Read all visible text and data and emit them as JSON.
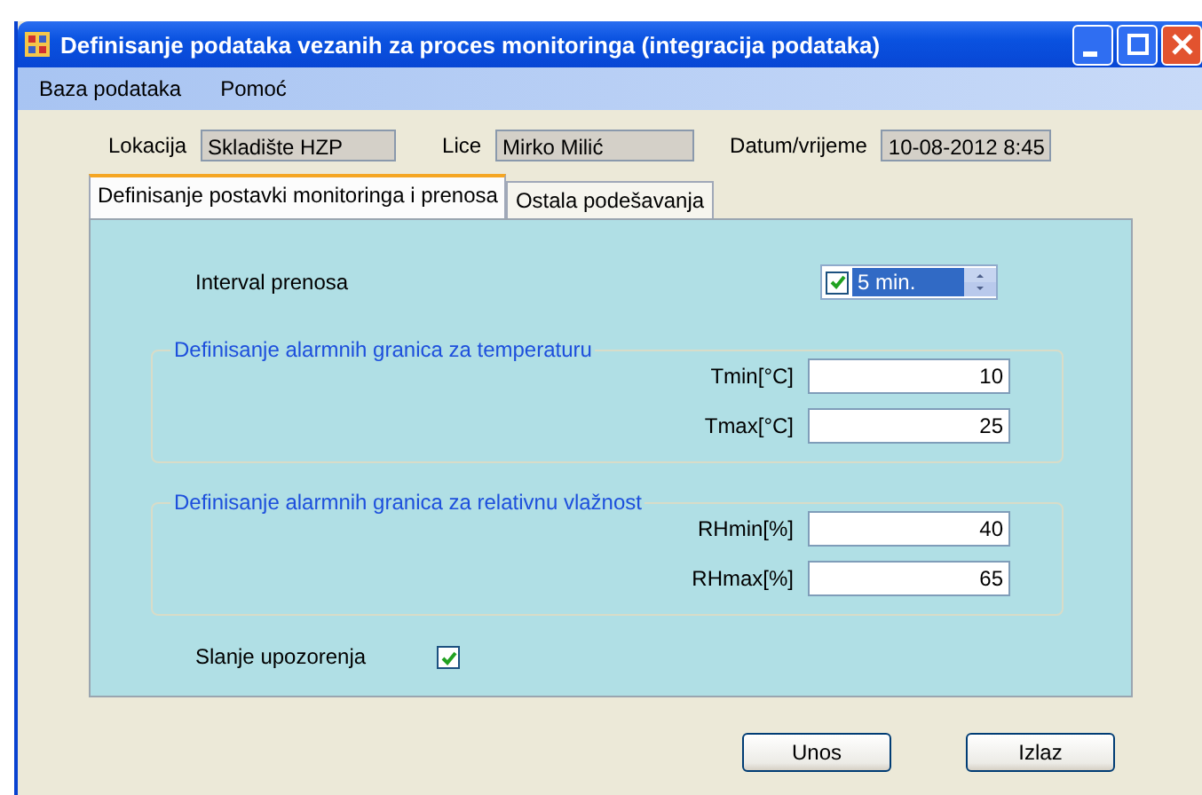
{
  "window": {
    "title": "Definisanje podataka vezanih za proces monitoringa (integracija podataka)"
  },
  "menu": [
    "Baza podataka",
    "Pomoć"
  ],
  "info": [
    {
      "label": "Lokacija",
      "value": "Skladište HZP"
    },
    {
      "label": "Lice",
      "value": "Mirko Milić"
    },
    {
      "label": "Datum/vrijeme",
      "value": "10-08-2012 8:45"
    }
  ],
  "tabs": [
    {
      "label": "Definisanje postavki monitoringa i prenosa",
      "selected": true
    },
    {
      "label": "Ostala podešavanja",
      "selected": false
    }
  ],
  "interval": {
    "label": "Interval prenosa",
    "checked": true,
    "value": "5 min."
  },
  "groups": [
    {
      "title": "Definisanje alarmnih granica za temperaturu",
      "fields": [
        {
          "label": "Tmin[°C]",
          "value": "10"
        },
        {
          "label": "Tmax[°C]",
          "value": "25"
        }
      ]
    },
    {
      "title": "Definisanje alarmnih granica za relativnu vlažnost",
      "fields": [
        {
          "label": "RHmin[%]",
          "value": "40"
        },
        {
          "label": "RHmax[%]",
          "value": "65"
        }
      ]
    }
  ],
  "warning": {
    "label": "Slanje upozorenja",
    "checked": true
  },
  "buttons": [
    "Unos",
    "Izlaz"
  ]
}
